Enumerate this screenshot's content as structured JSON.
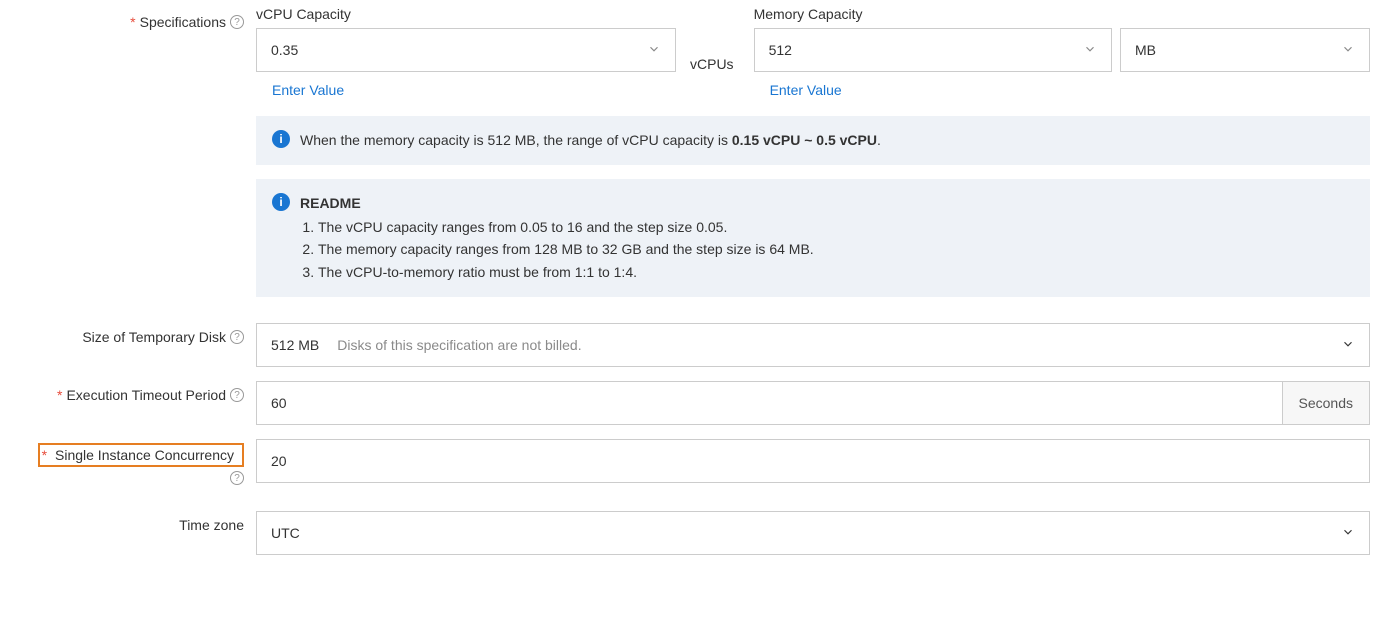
{
  "specifications": {
    "label": "Specifications",
    "vcpu": {
      "title": "vCPU Capacity",
      "value": "0.35",
      "unit": "vCPUs",
      "enter_link": "Enter Value"
    },
    "memory": {
      "title": "Memory Capacity",
      "value": "512",
      "unit": "MB",
      "enter_link": "Enter Value"
    },
    "hint_prefix": "When the memory capacity is 512 MB, the range of vCPU capacity is ",
    "hint_bold": "0.15 vCPU ~ 0.5 vCPU",
    "hint_suffix": ".",
    "readme_title": "README",
    "readme_items": [
      "The vCPU capacity ranges from 0.05 to 16 and the step size 0.05.",
      "The memory capacity ranges from 128 MB to 32 GB and the step size is 64 MB.",
      "The vCPU-to-memory ratio must be from 1:1 to 1:4."
    ]
  },
  "disk": {
    "label": "Size of Temporary Disk",
    "value": "512 MB",
    "desc": "Disks of this specification are not billed."
  },
  "timeout": {
    "label": "Execution Timeout Period",
    "value": "60",
    "unit": "Seconds"
  },
  "concurrency": {
    "label": "Single Instance Concurrency",
    "value": "20"
  },
  "timezone": {
    "label": "Time zone",
    "value": "UTC"
  }
}
